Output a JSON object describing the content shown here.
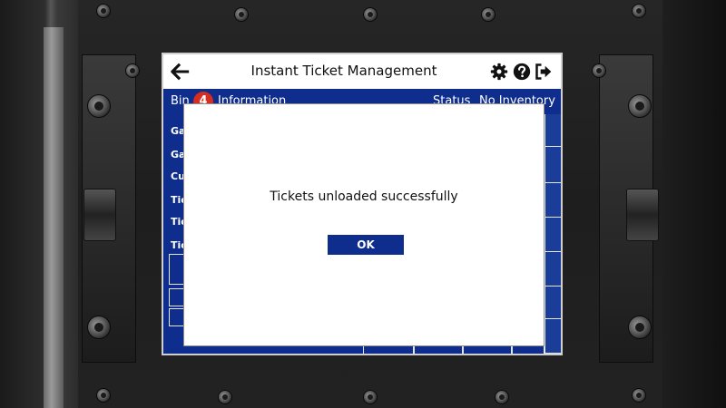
{
  "app": {
    "title": "Instant Ticket Management",
    "back_icon": "arrow-left-icon",
    "settings_icon": "gear-icon",
    "help_icon": "help-icon",
    "logout_icon": "logout-icon"
  },
  "bin_bar": {
    "label": "Bin",
    "number": "4",
    "info": "Information",
    "status_label": "Status",
    "status_value": "No Inventory"
  },
  "rows": [
    {
      "label": "Ga"
    },
    {
      "label": "Ga"
    },
    {
      "label": "Cu"
    },
    {
      "label": "Tic"
    },
    {
      "label": "Tic"
    },
    {
      "label": "Tic"
    }
  ],
  "dialog": {
    "message": "Tickets unloaded successfully",
    "ok_label": "OK"
  },
  "colors": {
    "brand_blue": "#0e2d8c",
    "badge_red": "#d62d20"
  }
}
